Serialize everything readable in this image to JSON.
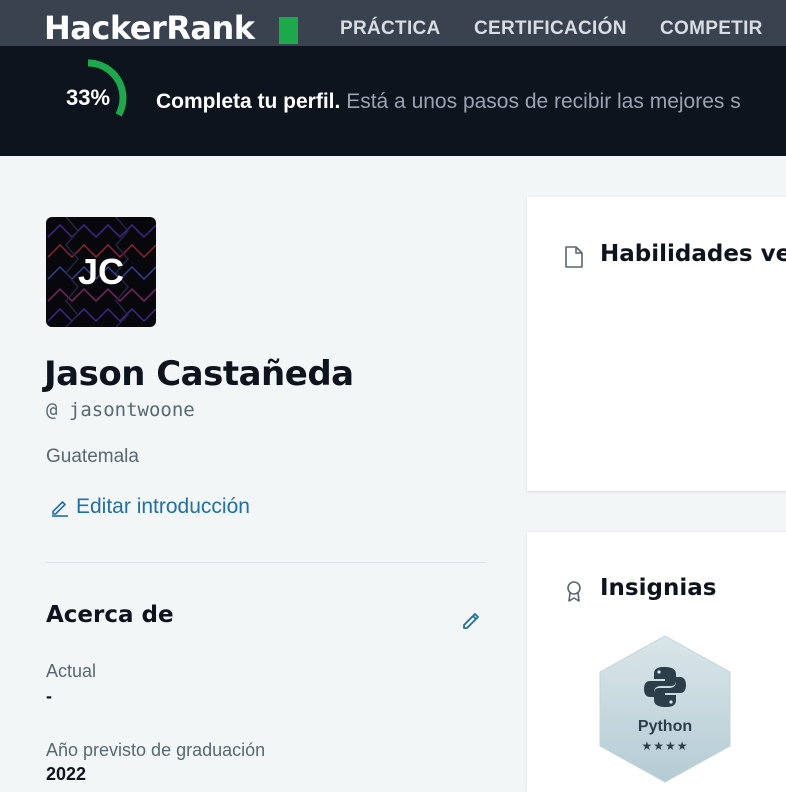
{
  "nav": {
    "logo_text": "HackerRank",
    "items": [
      "PRÁCTICA",
      "CERTIFICACIÓN",
      "COMPETIR"
    ]
  },
  "banner": {
    "progress_label": "33%",
    "progress_fraction": 0.33,
    "headline": "Completa tu perfil.",
    "message": "Está a unos pasos de recibir las mejores s"
  },
  "profile": {
    "initials": "JC",
    "name": "Jason Castañeda",
    "handle": "@ jasontwoone",
    "country": "Guatemala",
    "edit_intro_label": "Editar introducción"
  },
  "about": {
    "title": "Acerca de",
    "fields": [
      {
        "label": "Actual",
        "value": "-"
      },
      {
        "label": "Año previsto de graduación",
        "value": "2022"
      }
    ]
  },
  "cards": {
    "skills_title": "Habilidades ver",
    "badges_title": "Insignias"
  },
  "badge": {
    "name": "Python",
    "stars": "★★★★",
    "star_count": 4
  },
  "colors": {
    "accent": "#1ba94c",
    "nav_bg": "#39424e",
    "banner_bg": "#0e141e",
    "link": "#1f6fa8"
  }
}
